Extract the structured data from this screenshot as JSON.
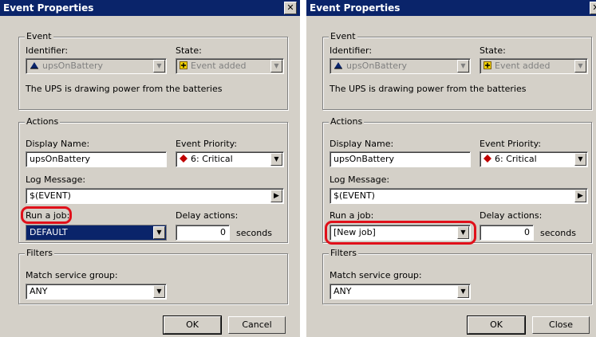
{
  "left": {
    "title": "Event Properties",
    "close_glyph": "✕",
    "event_group": "Event",
    "identifier_label": "Identifier:",
    "identifier_value": "upsOnBattery",
    "state_label": "State:",
    "state_value": "Event added",
    "description": "The UPS is drawing power from the batteries",
    "actions_group": "Actions",
    "display_name_label": "Display Name:",
    "display_name_value": "upsOnBattery",
    "priority_label": "Event Priority:",
    "priority_value": "6: Critical",
    "log_message_label": "Log Message:",
    "log_message_value": "$(EVENT)",
    "run_job_label": "Run a job:",
    "run_job_value": "DEFAULT",
    "delay_label": "Delay actions:",
    "delay_value": "0",
    "seconds_label": "seconds",
    "filters_group": "Filters",
    "match_label": "Match service group:",
    "match_value": "ANY",
    "ok_label": "OK",
    "cancel_label": "Cancel"
  },
  "right": {
    "title": "Event Properties",
    "event_group": "Event",
    "identifier_label": "Identifier:",
    "identifier_value": "upsOnBattery",
    "state_label": "State:",
    "state_value": "Event added",
    "description": "The UPS is drawing power from the batteries",
    "actions_group": "Actions",
    "display_name_label": "Display Name:",
    "display_name_value": "upsOnBattery",
    "priority_label": "Event Priority:",
    "priority_value": "6: Critical",
    "log_message_label": "Log Message:",
    "log_message_value": "$(EVENT)",
    "run_job_label": "Run a job:",
    "run_job_value": "[New job]",
    "delay_label": "Delay actions:",
    "delay_value": "0",
    "seconds_label": "seconds",
    "filters_group": "Filters",
    "match_label": "Match service group:",
    "match_value": "ANY",
    "ok_label": "OK",
    "close_label": "Close"
  },
  "colors": {
    "titlebar": "#0a246a",
    "dialog_bg": "#d4d0c8",
    "highlight": "#e0101a",
    "critical": "#c00000",
    "state_icon": "#f0d000"
  }
}
